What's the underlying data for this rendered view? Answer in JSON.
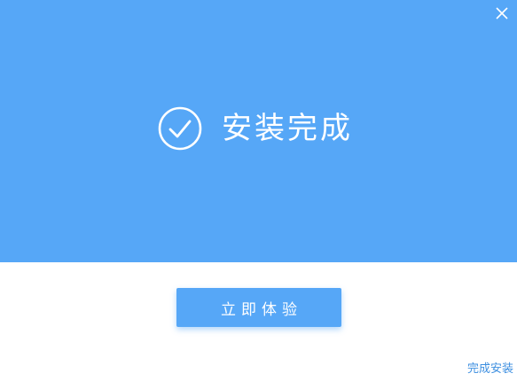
{
  "window": {
    "close_icon": "close-icon"
  },
  "status": {
    "icon": "check-circle-icon",
    "text": "安装完成"
  },
  "actions": {
    "primary_label": "立即体验",
    "footer_link": "完成安装"
  },
  "colors": {
    "banner": "#56a7f7",
    "primary_button": "#56a7f7",
    "link": "#3d8fe0",
    "background": "#ffffff"
  }
}
